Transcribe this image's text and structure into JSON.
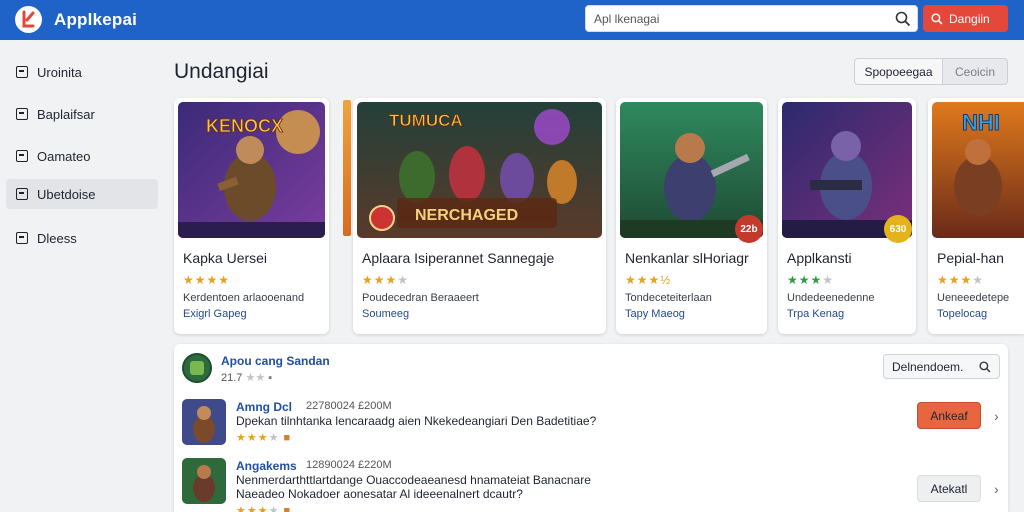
{
  "app": {
    "name": "Applkepai",
    "brand_color": "#1f63c9",
    "logo_icon": "app-logo"
  },
  "search": {
    "placeholder": "Apl lkenagai"
  },
  "topbar_button": {
    "label": "Dangiin",
    "icon": "search-icon",
    "color": "#e4483a"
  },
  "sidebar": {
    "items": [
      {
        "label": "Uroinita",
        "icon": "square-icon"
      },
      {
        "label": "Baplaifsar",
        "icon": "square-icon"
      },
      {
        "label": "Oamateo",
        "icon": "square-icon"
      },
      {
        "label": "Ubetdoise",
        "icon": "square-icon",
        "active": true
      },
      {
        "label": "Dleess",
        "icon": "square-icon"
      }
    ]
  },
  "main": {
    "title": "Undangiai",
    "segments": [
      "Spopoeegaa",
      "Ceoicin"
    ]
  },
  "cards": [
    {
      "art_text": "KENOCX",
      "title": "Kapka Uersei",
      "rating": 4,
      "star_color": "#e6a21c",
      "line1": "Kerdentoen arlaooenand",
      "line2": "Exigrl Gapeg"
    },
    {
      "art_text": "NERCHAGED",
      "title": "Aplaara Isiperannet Sannegaje",
      "rating": 3,
      "star_color": "#e6a21c",
      "line1": "Poudecedran Beraaeert",
      "line2": "Soumeeg"
    },
    {
      "art_text": "",
      "badge": "22b",
      "title": "Nenkanlar slHoriagr",
      "rating": 3.5,
      "star_color": "#e6a21c",
      "line1": "Tondeceteiterlaan",
      "line2": "Tapy Maeog"
    },
    {
      "art_text": "",
      "badge": "630",
      "title": "Applkansti",
      "rating": 3,
      "star_color": "#2f9a47",
      "line1": "Undedeenedenne",
      "line2": "Trpa Kenag"
    },
    {
      "art_text": "NHI",
      "title": "Pepial-han",
      "rating": 3,
      "star_color": "#e6a21c",
      "line1": "Ueneeedetepe",
      "line2": "Topelocag"
    }
  ],
  "panel": {
    "title": "Apou cang Sandan",
    "meta": "21.7",
    "filter_label": "Delnendoem.",
    "reviews": [
      {
        "name": "Amng Dcl",
        "time": "22780024 £200M",
        "text_lines": [
          "Dpekan tilnhtanka lencaraadg aien Nkekedeangiari Den Badetitiae?"
        ],
        "rating": 3,
        "button": "Ankeaf"
      },
      {
        "name": "Angakems",
        "time": "12890024 £220M",
        "text_lines": [
          "Nenmerdarthttlartdange Ouaccodeaeanesd hnamateiat Banacnare",
          "Naeadeo Nokadoer aonesatar Al ideeenalnert dcautr?"
        ],
        "rating": 3,
        "button": "Atekatl"
      }
    ]
  }
}
